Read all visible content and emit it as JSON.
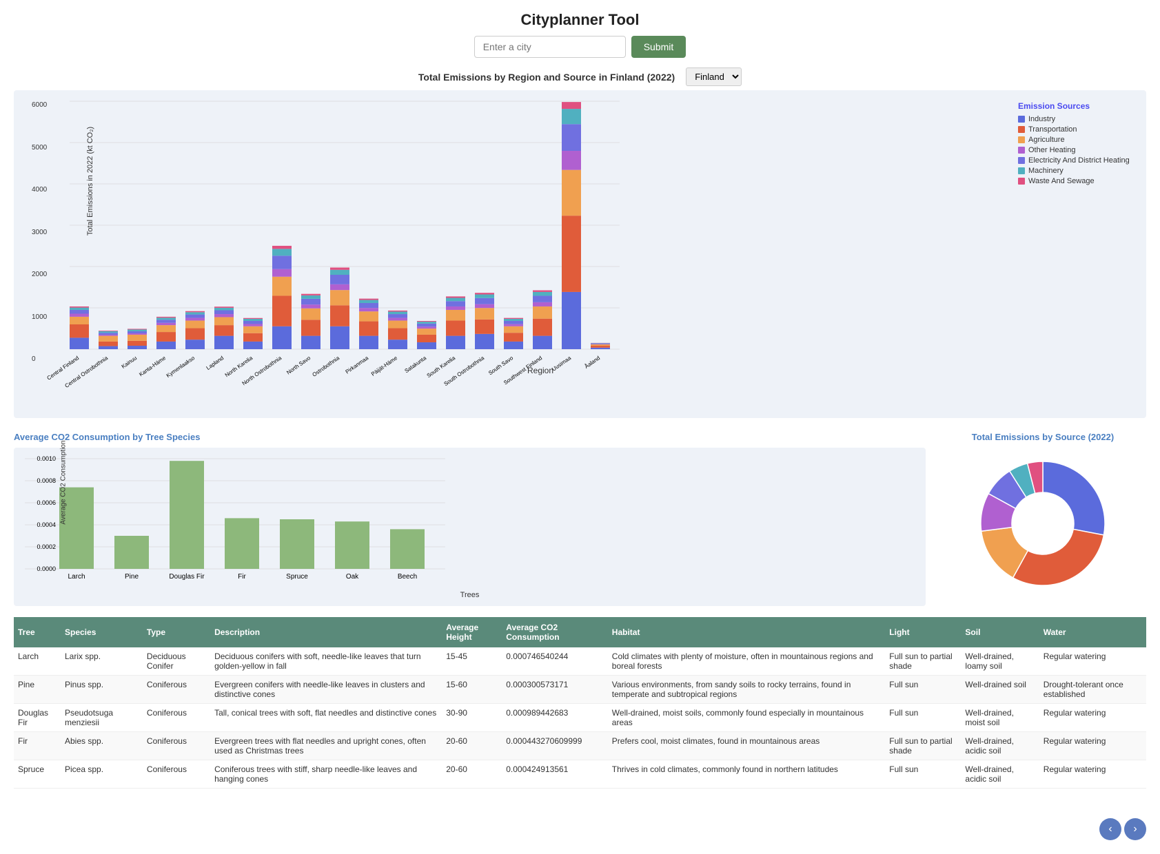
{
  "header": {
    "title": "Cityplanner Tool"
  },
  "search": {
    "placeholder": "Enter a city",
    "button_label": "Submit"
  },
  "bar_chart": {
    "title": "Total Emissions by Region and Source in Finland (2022)",
    "country_select": {
      "value": "Finland",
      "options": [
        "Finland"
      ]
    },
    "y_axis_label": "Total Emissions in 2022 (kt CO₂)",
    "x_axis_label": "Region",
    "y_ticks": [
      "0",
      "1000",
      "2000",
      "3000",
      "4000",
      "5000",
      "6000"
    ],
    "legend": {
      "title": "Emission Sources",
      "items": [
        {
          "label": "Industry",
          "color": "#5b6bdc"
        },
        {
          "label": "Transportation",
          "color": "#e05c3a"
        },
        {
          "label": "Agriculture",
          "color": "#f0a050"
        },
        {
          "label": "Other Heating",
          "color": "#b060d0"
        },
        {
          "label": "Electricity And District Heating",
          "color": "#7070e0"
        },
        {
          "label": "Machinery",
          "color": "#50b0c0"
        },
        {
          "label": "Waste And Sewage",
          "color": "#e05080"
        }
      ]
    },
    "regions": [
      {
        "name": "Central Finland",
        "values": [
          300,
          350,
          200,
          80,
          100,
          60,
          30
        ]
      },
      {
        "name": "Central Ostrobothnia",
        "values": [
          80,
          120,
          150,
          30,
          50,
          40,
          15
        ]
      },
      {
        "name": "Kainuu",
        "values": [
          90,
          130,
          160,
          35,
          55,
          45,
          18
        ]
      },
      {
        "name": "Kanta-Häme",
        "values": [
          200,
          250,
          180,
          60,
          80,
          55,
          25
        ]
      },
      {
        "name": "Kymenlaakso",
        "values": [
          250,
          300,
          200,
          70,
          90,
          60,
          28
        ]
      },
      {
        "name": "Lapland",
        "values": [
          350,
          280,
          210,
          80,
          100,
          65,
          30
        ]
      },
      {
        "name": "North Karelia",
        "values": [
          200,
          220,
          180,
          60,
          80,
          55,
          22
        ]
      },
      {
        "name": "North Ostrobothnia",
        "values": [
          600,
          800,
          500,
          200,
          350,
          180,
          80
        ]
      },
      {
        "name": "North Savo",
        "values": [
          350,
          420,
          300,
          100,
          150,
          90,
          40
        ]
      },
      {
        "name": "Ostrobothnia",
        "values": [
          600,
          550,
          400,
          150,
          250,
          130,
          60
        ]
      },
      {
        "name": "Pirkanmaa",
        "values": [
          350,
          380,
          260,
          90,
          130,
          80,
          35
        ]
      },
      {
        "name": "Päijät-Häme",
        "values": [
          250,
          300,
          200,
          70,
          100,
          65,
          28
        ]
      },
      {
        "name": "Satakunta",
        "values": [
          180,
          200,
          160,
          50,
          80,
          50,
          20
        ]
      },
      {
        "name": "South Karelia",
        "values": [
          350,
          400,
          280,
          90,
          140,
          85,
          38
        ]
      },
      {
        "name": "South Ostrobothnia",
        "values": [
          400,
          380,
          300,
          100,
          160,
          95,
          42
        ]
      },
      {
        "name": "South Savo",
        "values": [
          200,
          230,
          170,
          55,
          85,
          55,
          24
        ]
      },
      {
        "name": "Southwest Finland",
        "values": [
          350,
          450,
          320,
          110,
          170,
          100,
          44
        ]
      },
      {
        "name": "Uusimaa",
        "values": [
          1500,
          2000,
          1200,
          500,
          700,
          400,
          180
        ]
      },
      {
        "name": "Åaland",
        "values": [
          40,
          50,
          35,
          10,
          15,
          10,
          5
        ]
      }
    ]
  },
  "tree_chart": {
    "title": "Average CO2 Consumption by Tree Species",
    "y_axis_label": "Average CO2 Consumption",
    "x_axis_label": "Trees",
    "max_value": 0.001,
    "trees": [
      {
        "name": "Larch",
        "value": 0.00074
      },
      {
        "name": "Pine",
        "value": 0.0003
      },
      {
        "name": "Douglas Fir",
        "value": 0.00098
      },
      {
        "name": "Fir",
        "value": 0.00046
      },
      {
        "name": "Spruce",
        "value": 0.00045
      },
      {
        "name": "Oak",
        "value": 0.00043
      },
      {
        "name": "Beech",
        "value": 0.00036
      }
    ]
  },
  "pie_chart": {
    "title": "Total Emissions by Source (2022)",
    "segments": [
      {
        "label": "Industry",
        "color": "#5b6bdc",
        "percent": 28
      },
      {
        "label": "Transportation",
        "color": "#e05c3a",
        "percent": 30
      },
      {
        "label": "Agriculture",
        "color": "#f0a050",
        "percent": 15
      },
      {
        "label": "Other Heating",
        "color": "#b060d0",
        "percent": 10
      },
      {
        "label": "Electricity And District Heating",
        "color": "#7070e0",
        "percent": 8
      },
      {
        "label": "Machinery",
        "color": "#50b0c0",
        "percent": 5
      },
      {
        "label": "Waste And Sewage",
        "color": "#e05080",
        "percent": 4
      }
    ]
  },
  "table": {
    "headers": [
      "Tree",
      "Species",
      "Type",
      "Description",
      "Average Height",
      "Average CO2 Consumption",
      "Habitat",
      "Light",
      "Soil",
      "Water"
    ],
    "rows": [
      {
        "tree": "Larch",
        "species": "Larix spp.",
        "type": "Deciduous Conifer",
        "description": "Deciduous conifers with soft, needle-like leaves that turn golden-yellow in fall",
        "avg_height": "15-45",
        "avg_co2": "0.000746540244",
        "habitat": "Cold climates with plenty of moisture, often in mountainous regions and boreal forests",
        "light": "Full sun to partial shade",
        "soil": "Well-drained, loamy soil",
        "water": "Regular watering"
      },
      {
        "tree": "Pine",
        "species": "Pinus spp.",
        "type": "Coniferous",
        "description": "Evergreen conifers with needle-like leaves in clusters and distinctive cones",
        "avg_height": "15-60",
        "avg_co2": "0.000300573171",
        "habitat": "Various environments, from sandy soils to rocky terrains, found in temperate and subtropical regions",
        "light": "Full sun",
        "soil": "Well-drained soil",
        "water": "Drought-tolerant once established"
      },
      {
        "tree": "Douglas Fir",
        "species": "Pseudotsuga menziesii",
        "type": "Coniferous",
        "description": "Tall, conical trees with soft, flat needles and distinctive cones",
        "avg_height": "30-90",
        "avg_co2": "0.000989442683",
        "habitat": "Well-drained, moist soils, commonly found especially in mountainous areas",
        "light": "Full sun",
        "soil": "Well-drained, moist soil",
        "water": "Regular watering"
      },
      {
        "tree": "Fir",
        "species": "Abies spp.",
        "type": "Coniferous",
        "description": "Evergreen trees with flat needles and upright cones, often used as Christmas trees",
        "avg_height": "20-60",
        "avg_co2": "0.000443270609999",
        "habitat": "Prefers cool, moist climates, found in mountainous areas",
        "light": "Full sun to partial shade",
        "soil": "Well-drained, acidic soil",
        "water": "Regular watering"
      },
      {
        "tree": "Spruce",
        "species": "Picea spp.",
        "type": "Coniferous",
        "description": "Coniferous trees with stiff, sharp needle-like leaves and hanging cones",
        "avg_height": "20-60",
        "avg_co2": "0.000424913561",
        "habitat": "Thrives in cold climates, commonly found in northern latitudes",
        "light": "Full sun",
        "soil": "Well-drained, acidic soil",
        "water": "Regular watering"
      }
    ]
  },
  "nav": {
    "left_label": "‹",
    "right_label": "›"
  }
}
